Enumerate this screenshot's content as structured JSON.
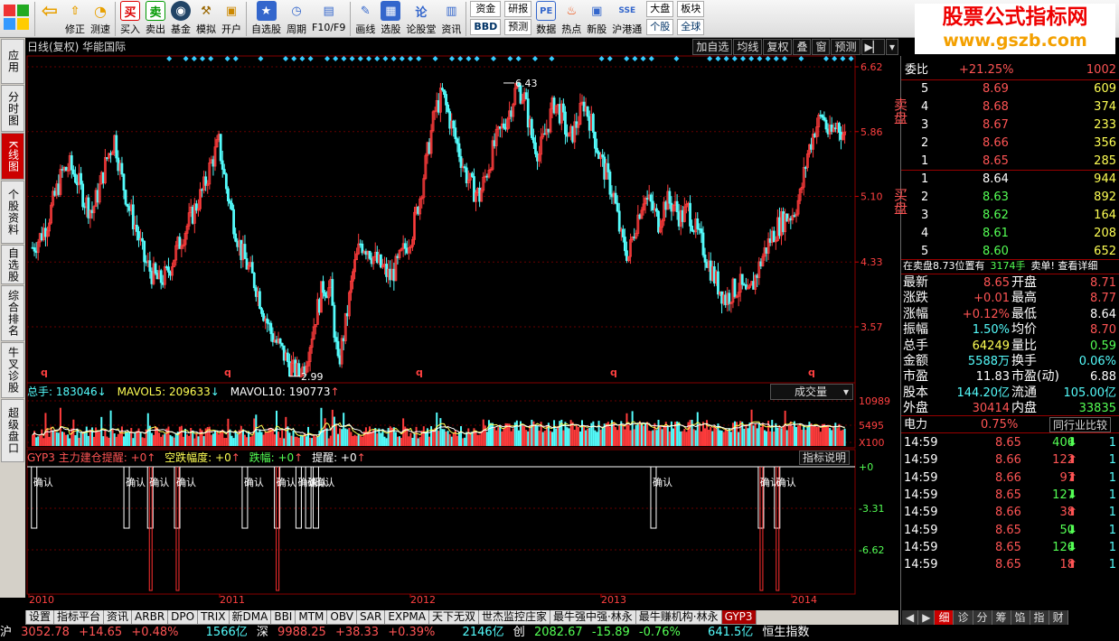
{
  "toolbar": {
    "items": [
      {
        "label": "修正",
        "icon": "up-arrow-icon"
      },
      {
        "label": "测速",
        "icon": "gauge-icon"
      },
      {
        "label": "买入",
        "icon": "buy-icon",
        "glyph": "买"
      },
      {
        "label": "卖出",
        "icon": "sell-icon",
        "glyph": "卖"
      },
      {
        "label": "基金",
        "icon": "fund-icon"
      },
      {
        "label": "模拟",
        "icon": "hammer-icon"
      },
      {
        "label": "开户",
        "icon": "lock-icon"
      },
      {
        "label": "自选股",
        "icon": "favorites-icon"
      },
      {
        "label": "周期",
        "icon": "clock-icon"
      },
      {
        "label": "F10/F9",
        "icon": "f10-icon"
      },
      {
        "label": "画线",
        "icon": "pen-icon"
      },
      {
        "label": "选股",
        "icon": "screen-icon"
      },
      {
        "label": "论股堂",
        "icon": "forum-icon",
        "glyph": "论"
      },
      {
        "label": "资讯",
        "icon": "news-icon"
      }
    ],
    "fund_label": "资金",
    "bbd_label": "BBD",
    "research_label": "研报",
    "forecast_label": "预测",
    "data_label": "数据",
    "hot_label": "热点",
    "ipo_label": "新股",
    "hk_label": "沪港通",
    "market_label": "大盘",
    "sector_label": "板块",
    "single_label": "个股",
    "global_label": "全球"
  },
  "brand": {
    "line1": "股票公式指标网",
    "line2": "www.gszb.com"
  },
  "lefttabs": [
    "应用",
    "分时图",
    "K线图",
    "个股资料",
    "自选股",
    "综合排名",
    "牛叉诊股",
    "超级盘口"
  ],
  "header": {
    "title": "日线(复权) 华能国际",
    "buttons": [
      "加自选",
      "均线",
      "复权",
      "叠",
      "窗",
      "预测"
    ]
  },
  "chart_data": [
    {
      "type": "candlestick",
      "title": "日线(复权) 华能国际",
      "y_ticks": [
        "6.62",
        "5.86",
        "5.10",
        "4.33",
        "3.57"
      ],
      "annotations": [
        "6.43",
        "2.99"
      ],
      "x_ticks": [
        "2010",
        "2011",
        "2012",
        "2013",
        "2014"
      ],
      "close": [
        4.5,
        4.62,
        4.8,
        5.1,
        5.38,
        5.45,
        5.3,
        5.05,
        4.92,
        5.2,
        5.55,
        5.78,
        5.3,
        4.95,
        4.7,
        4.35,
        4.2,
        4.1,
        4.18,
        4.4,
        4.62,
        4.8,
        5.0,
        5.2,
        5.5,
        5.72,
        5.2,
        4.8,
        4.45,
        4.25,
        4.05,
        3.75,
        3.5,
        3.35,
        3.2,
        3.05,
        3.0,
        3.3,
        3.7,
        4.05,
        4.0,
        3.1,
        3.6,
        4.2,
        4.55,
        4.5,
        4.35,
        4.25,
        4.15,
        4.3,
        4.5,
        4.7,
        5.1,
        5.6,
        6.1,
        6.3,
        6.0,
        5.7,
        5.4,
        5.2,
        5.1,
        5.4,
        5.7,
        5.9,
        6.1,
        6.4,
        6.25,
        5.8,
        5.6,
        5.9,
        6.2,
        6.05,
        5.75,
        5.95,
        6.2,
        5.95,
        5.6,
        5.35,
        5.1,
        4.6,
        4.4,
        4.8,
        5.1,
        5.0,
        4.8,
        5.05,
        5.0,
        4.85,
        4.95,
        4.7,
        4.5,
        4.25,
        4.05,
        3.9,
        4.0,
        4.05,
        3.9,
        4.15,
        4.4,
        4.6,
        4.75,
        4.85,
        4.9,
        5.1,
        5.6,
        5.9,
        6.05,
        5.8,
        5.95,
        5.8
      ]
    },
    {
      "type": "bar",
      "title": "成交量",
      "series_labels": [
        "总手: 183046",
        "MAVOL5: 209633",
        "MAVOL10: 190773"
      ],
      "y_ticks": [
        "10989",
        "5495",
        "X100"
      ]
    },
    {
      "type": "step",
      "title": "GYP3",
      "series_labels": [
        "GYP3 主力建仓提醒: +0",
        "空跌幅度: +0",
        "跌幅: +0",
        "提醒: +0"
      ],
      "y_ticks": [
        "+0",
        "-3.31",
        "-6.62"
      ],
      "marker_label": "确认",
      "signals": [
        0.4,
        9.0,
        11.2,
        13.7,
        20.0,
        23.0,
        25.0,
        25.9,
        26.6,
        58.0,
        68.0,
        69.5
      ]
    }
  ],
  "volume": {
    "total": "总手: 183046",
    "mavol5": "MAVOL5: 209633",
    "mavol10": "MAVOL10: 190773",
    "selector": "成交量"
  },
  "gyp": {
    "a": "GYP3 主力建仓提醒: +0",
    "b": "空跌幅度: +0",
    "c": "跌幅: +0",
    "d": "提醒: +0",
    "btn": "指标说明"
  },
  "bottomtabs": [
    "设置",
    "指标平台",
    "资讯",
    "ARBR",
    "DPO",
    "TRIX",
    "新DMA",
    "BBI",
    "MTM",
    "OBV",
    "SAR",
    "EXPMA",
    "天下无双",
    "世杰监控庄家",
    "最牛强中强·林永",
    "最牛赚机构·林永",
    "GYP3"
  ],
  "right": {
    "weibi": {
      "label": "委比",
      "pct": "+21.25%",
      "val": "1002"
    },
    "sell": [
      {
        "n": "5",
        "p": "8.69",
        "v": "609"
      },
      {
        "n": "4",
        "p": "8.68",
        "v": "374"
      },
      {
        "n": "3",
        "p": "8.67",
        "v": "233"
      },
      {
        "n": "2",
        "p": "8.66",
        "v": "356"
      },
      {
        "n": "1",
        "p": "8.65",
        "v": "285"
      }
    ],
    "sell_label": "卖盘",
    "buy_label": "买盘",
    "buy": [
      {
        "n": "1",
        "p": "8.64",
        "v": "944"
      },
      {
        "n": "2",
        "p": "8.63",
        "v": "892"
      },
      {
        "n": "3",
        "p": "8.62",
        "v": "164"
      },
      {
        "n": "4",
        "p": "8.61",
        "v": "208"
      },
      {
        "n": "5",
        "p": "8.60",
        "v": "652"
      }
    ],
    "notice": "在卖盘8.73位置有",
    "notice_hand": "3174手",
    "notice_tail": "卖单! 查看详细",
    "quote": [
      [
        "最新",
        "8.65",
        "开盘",
        "8.71"
      ],
      [
        "涨跌",
        "+0.01",
        "最高",
        "8.77"
      ],
      [
        "涨幅",
        "+0.12%",
        "最低",
        "8.64"
      ],
      [
        "振幅",
        "1.50%",
        "均价",
        "8.70"
      ],
      [
        "总手",
        "64249",
        "量比",
        "0.59"
      ],
      [
        "金额",
        "5588万",
        "换手",
        "0.06%"
      ],
      [
        "市盈",
        "11.83",
        "市盈(动)",
        "6.88"
      ],
      [
        "股本",
        "144.20亿",
        "流通",
        "105.00亿"
      ],
      [
        "外盘",
        "30414",
        "内盘",
        "33835"
      ]
    ],
    "sector": "电力",
    "sector_pct": "0.75%",
    "peer_btn": "同行业比较",
    "ticks": [
      {
        "t": "14:59",
        "p": "8.65",
        "v": "406",
        "d": "down"
      },
      {
        "t": "14:59",
        "p": "8.66",
        "v": "122",
        "d": "up"
      },
      {
        "t": "14:59",
        "p": "8.66",
        "v": "97",
        "d": "up"
      },
      {
        "t": "14:59",
        "p": "8.65",
        "v": "127",
        "d": "down"
      },
      {
        "t": "14:59",
        "p": "8.66",
        "v": "38",
        "d": "up"
      },
      {
        "t": "14:59",
        "p": "8.65",
        "v": "50",
        "d": "down"
      },
      {
        "t": "14:59",
        "p": "8.65",
        "v": "126",
        "d": "down"
      },
      {
        "t": "14:59",
        "p": "8.65",
        "v": "18",
        "d": "up"
      }
    ],
    "tick_count": "1",
    "tabs": [
      "细",
      "诊",
      "分",
      "筹",
      "馅",
      "指",
      "财"
    ]
  },
  "status": {
    "sh": "沪",
    "sh_idx": "3052.78",
    "sh_chg": "+14.65",
    "sh_pct": "+0.48%",
    "sh_amt": "1566亿",
    "sz": "深",
    "sz_idx": "9988.25",
    "sz_chg": "+38.33",
    "sz_pct": "+0.39%",
    "sz_amt": "2146亿",
    "cy": "创",
    "cy_idx": "2082.67",
    "cy_chg": "-15.89",
    "cy_pct": "-0.76%",
    "cy_amt": "641.5亿",
    "hs": "恒生指数"
  }
}
